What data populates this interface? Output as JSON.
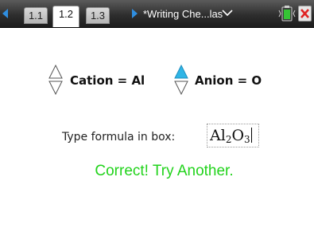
{
  "tabs": [
    {
      "label": "1.1"
    },
    {
      "label": "1.2"
    },
    {
      "label": "1.3"
    }
  ],
  "active_tab": 1,
  "document_title": "*Writing Che...las",
  "controls": {
    "cation_label": "Cation = Al",
    "anion_label": "Anion = O"
  },
  "prompt": "Type formula in box:",
  "answer": {
    "base1": "Al",
    "sub1": "2",
    "base2": "O",
    "sub2": "3"
  },
  "feedback": "Correct! Try Another.",
  "colors": {
    "feedback": "#22d31c",
    "accent": "#2f8ee0"
  }
}
